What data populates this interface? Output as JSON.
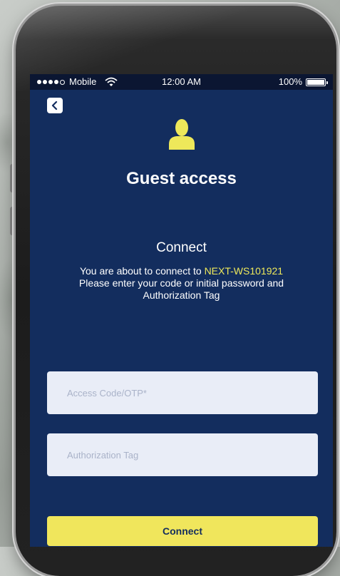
{
  "statusbar": {
    "carrier": "Mobile",
    "time": "12:00 AM",
    "battery": "100%",
    "battery_level": 1.0
  },
  "header": {
    "back_icon": "chevron-left-icon",
    "guest_icon": "user-silhouette-icon",
    "title": "Guest access"
  },
  "connect_section": {
    "heading": "Connect",
    "prefix": "You are about to connect to ",
    "network": "NEXT-WS101921",
    "line2": "Please enter your code or initial password and",
    "line3": "Authorization Tag"
  },
  "form": {
    "access_code_placeholder": "Access Code/OTP*",
    "auth_tag_placeholder": "Authorization Tag",
    "submit_label": "Connect"
  },
  "colors": {
    "screen_bg": "#132d5e",
    "accent": "#eee85a",
    "field_bg": "#e9edf7",
    "button_bg": "#f0e65c"
  }
}
